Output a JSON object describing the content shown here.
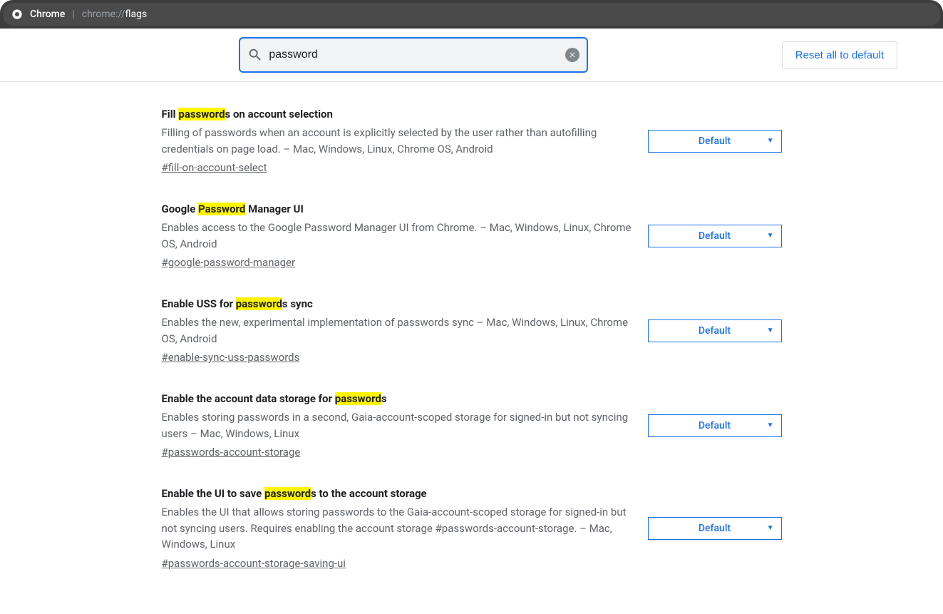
{
  "chrome": {
    "app": "Chrome",
    "url_prefix": "chrome://",
    "url_path": "flags"
  },
  "header": {
    "search_value": "password",
    "reset_label": "Reset all to default"
  },
  "highlight": "password",
  "flags": [
    {
      "title": "Fill passwords on account selection",
      "desc": "Filling of passwords when an account is explicitly selected by the user rather than autofilling credentials on page load. – Mac, Windows, Linux, Chrome OS, Android",
      "hash": "#fill-on-account-select",
      "value": "Default"
    },
    {
      "title": "Google Password Manager UI",
      "desc": "Enables access to the Google Password Manager UI from Chrome. – Mac, Windows, Linux, Chrome OS, Android",
      "hash": "#google-password-manager",
      "value": "Default"
    },
    {
      "title": "Enable USS for passwords sync",
      "desc": "Enables the new, experimental implementation of passwords sync – Mac, Windows, Linux, Chrome OS, Android",
      "hash": "#enable-sync-uss-passwords",
      "value": "Default"
    },
    {
      "title": "Enable the account data storage for passwords",
      "desc": "Enables storing passwords in a second, Gaia-account-scoped storage for signed-in but not syncing users – Mac, Windows, Linux",
      "hash": "#passwords-account-storage",
      "value": "Default"
    },
    {
      "title": "Enable the UI to save passwords to the account storage",
      "desc": "Enables the UI that allows storing passwords to the Gaia-account-scoped storage for signed-in but not syncing users. Requires enabling the account storage #passwords-account-storage. – Mac, Windows, Linux",
      "hash": "#passwords-account-storage-saving-ui",
      "value": "Default"
    }
  ]
}
